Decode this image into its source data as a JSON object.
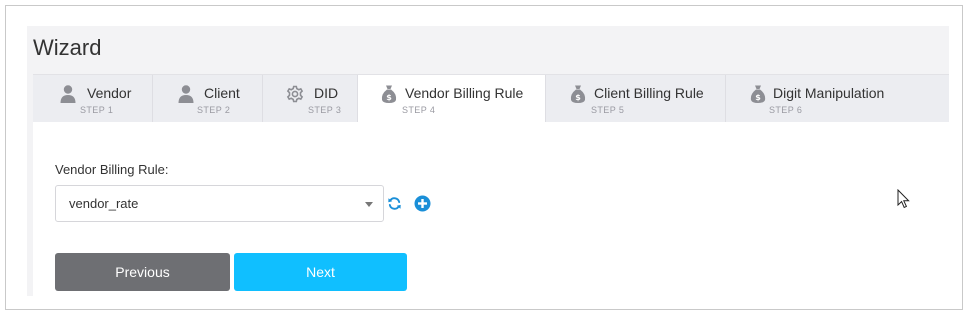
{
  "wizard": {
    "title": "Wizard",
    "tabs": [
      {
        "label": "Vendor",
        "step": "STEP 1",
        "icon": "user-icon",
        "active": false
      },
      {
        "label": "Client",
        "step": "STEP 2",
        "icon": "user-icon",
        "active": false
      },
      {
        "label": "DID",
        "step": "STEP 3",
        "icon": "gear-icon",
        "active": false
      },
      {
        "label": "Vendor Billing Rule",
        "step": "STEP 4",
        "icon": "money-bag-icon",
        "active": true
      },
      {
        "label": "Client Billing Rule",
        "step": "STEP 5",
        "icon": "money-bag-icon",
        "active": false
      },
      {
        "label": "Digit Manipulation",
        "step": "STEP 6",
        "icon": "money-bag-icon",
        "active": false
      }
    ]
  },
  "form": {
    "field_label": "Vendor Billing Rule:",
    "selected_value": "vendor_rate",
    "refresh_icon": "refresh-icon",
    "add_icon": "plus-circle-icon"
  },
  "buttons": {
    "previous_label": "Previous",
    "next_label": "Next"
  },
  "colors": {
    "accent": "#10bfff",
    "icon_blue": "#1a8fd8",
    "previous_bg": "#6e6f73",
    "tab_icon": "#8d8e94"
  }
}
